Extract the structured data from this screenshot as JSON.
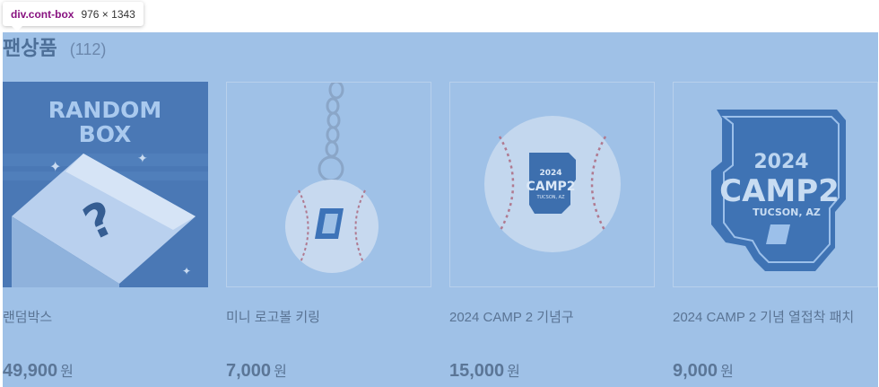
{
  "inspector": {
    "selector": "div.cont-box",
    "dimensions": "976 × 1343"
  },
  "section": {
    "title": "팬상품",
    "count": "(112)"
  },
  "products": [
    {
      "name": "랜덤박스",
      "price": "49,900",
      "unit": "원",
      "image_text_line1": "RANDOM",
      "image_text_line2": "BOX",
      "image_icon": "question-box-icon"
    },
    {
      "name": "미니 로고볼 키링",
      "price": "7,000",
      "unit": "원",
      "image_icon": "baseball-keyring-icon"
    },
    {
      "name": "2024 CAMP 2 기념구",
      "price": "15,000",
      "unit": "원",
      "image_text_line1": "2024",
      "image_text_line2": "CAMP2",
      "image_text_line3": "TUCSON, AZ",
      "image_icon": "baseball-icon"
    },
    {
      "name": "2024 CAMP 2 기념 열접착 패치",
      "price": "9,000",
      "unit": "원",
      "image_text_line1": "2024",
      "image_text_line2": "CAMP2",
      "image_text_line3": "TUCSON, AZ",
      "image_icon": "patch-icon"
    }
  ],
  "colors": {
    "overlay": "#9fc1e7",
    "accent": "#4d6f98"
  }
}
